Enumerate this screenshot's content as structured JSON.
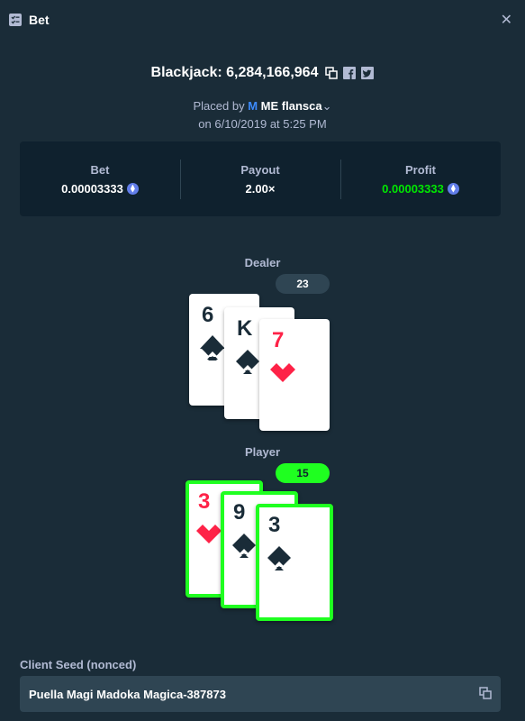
{
  "header": {
    "title": "Bet",
    "close_icon": "close-icon"
  },
  "game": {
    "title": "Blackjack: 6,284,166,964",
    "placed_by_prefix": "Placed by",
    "user_rank": "M",
    "user_name": "ME flansca",
    "placed_on": "on 6/10/2019 at 5:25 PM"
  },
  "stats": {
    "bet_label": "Bet",
    "bet_value": "0.00003333",
    "payout_label": "Payout",
    "payout_value": "2.00×",
    "profit_label": "Profit",
    "profit_value": "0.00003333"
  },
  "dealer": {
    "label": "Dealer",
    "total": "23",
    "cards": [
      {
        "rank": "6",
        "suit": "spade"
      },
      {
        "rank": "K",
        "suit": "spade"
      },
      {
        "rank": "7",
        "suit": "heart"
      }
    ]
  },
  "player": {
    "label": "Player",
    "total": "15",
    "cards": [
      {
        "rank": "3",
        "suit": "heart"
      },
      {
        "rank": "9",
        "suit": "spade"
      },
      {
        "rank": "3",
        "suit": "spade"
      }
    ]
  },
  "client_seed": {
    "label": "Client Seed (nonced)",
    "value": "Puella Magi Madoka Magica-387873"
  },
  "colors": {
    "background": "#1a2c38",
    "panel": "#0f212e",
    "win": "#1fff20",
    "red_suit": "#fe2247",
    "muted": "#b1bad3"
  }
}
